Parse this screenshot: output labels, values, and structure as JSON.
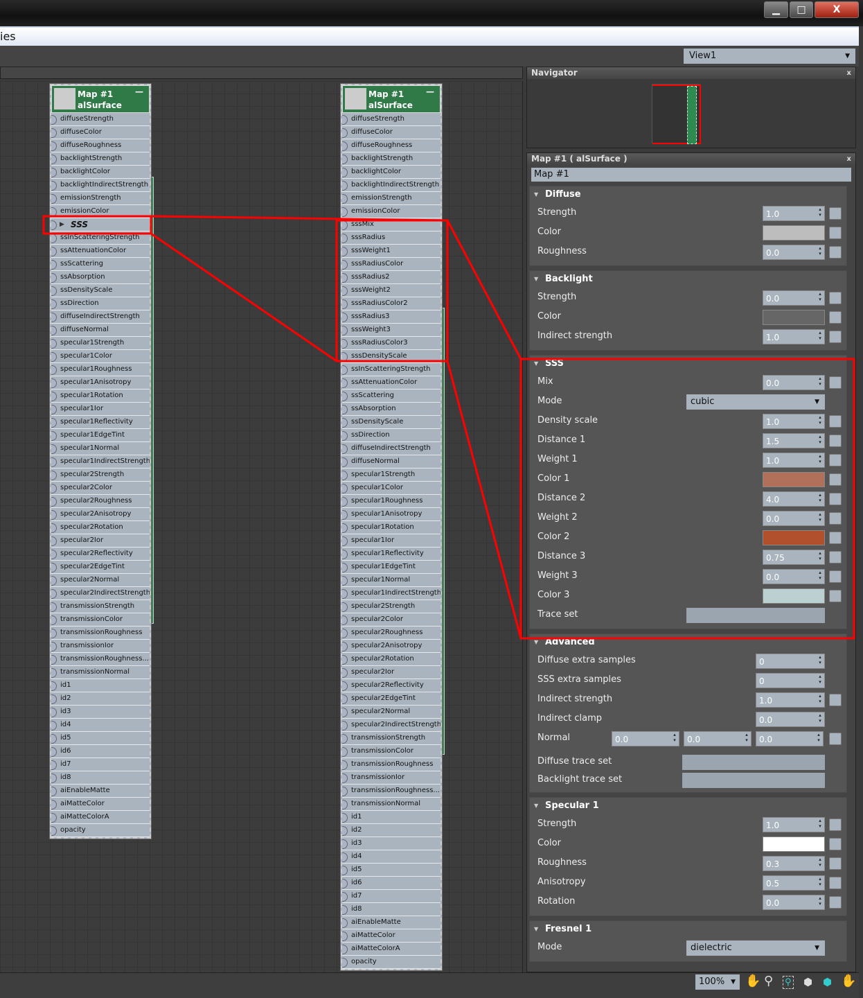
{
  "window": {
    "title_fragment": "ies",
    "view_select": "View1",
    "minimize": "▁",
    "maximize": "□",
    "close": "X"
  },
  "navigator": {
    "title": "Navigator",
    "close": "x"
  },
  "nodes": [
    {
      "title": "Map #1",
      "type": "alSurface",
      "ports": [
        "diffuseStrength",
        "diffuseColor",
        "diffuseRoughness",
        "backlightStrength",
        "backlightColor",
        "backlightIndirectStrength",
        "emissionStrength",
        "emissionColor",
        {
          "group": "SSS"
        },
        "ssInScatteringStrength",
        "ssAttenuationColor",
        "ssScattering",
        "ssAbsorption",
        "ssDensityScale",
        "ssDirection",
        "diffuseIndirectStrength",
        "diffuseNormal",
        "specular1Strength",
        "specular1Color",
        "specular1Roughness",
        "specular1Anisotropy",
        "specular1Rotation",
        "specular1Ior",
        "specular1Reflectivity",
        "specular1EdgeTint",
        "specular1Normal",
        "specular1IndirectStrength",
        "specular2Strength",
        "specular2Color",
        "specular2Roughness",
        "specular2Anisotropy",
        "specular2Rotation",
        "specular2Ior",
        "specular2Reflectivity",
        "specular2EdgeTint",
        "specular2Normal",
        "specular2IndirectStrength",
        "transmissionStrength",
        "transmissionColor",
        "transmissionRoughness",
        "transmissionIor",
        "transmissionRoughness...",
        "transmissionNormal",
        "id1",
        "id2",
        "id3",
        "id4",
        "id5",
        "id6",
        "id7",
        "id8",
        "aiEnableMatte",
        "aiMatteColor",
        "aiMatteColorA",
        "opacity"
      ]
    },
    {
      "title": "Map #1",
      "type": "alSurface",
      "ports": [
        "diffuseStrength",
        "diffuseColor",
        "diffuseRoughness",
        "backlightStrength",
        "backlightColor",
        "backlightIndirectStrength",
        "emissionStrength",
        "emissionColor",
        "sssMix",
        "sssRadius",
        "sssWeight1",
        "sssRadiusColor",
        "sssRadius2",
        "sssWeight2",
        "sssRadiusColor2",
        "sssRadius3",
        "sssWeight3",
        "sssRadiusColor3",
        "sssDensityScale",
        "ssInScatteringStrength",
        "ssAttenuationColor",
        "ssScattering",
        "ssAbsorption",
        "ssDensityScale",
        "ssDirection",
        "diffuseIndirectStrength",
        "diffuseNormal",
        "specular1Strength",
        "specular1Color",
        "specular1Roughness",
        "specular1Anisotropy",
        "specular1Rotation",
        "specular1Ior",
        "specular1Reflectivity",
        "specular1EdgeTint",
        "specular1Normal",
        "specular1IndirectStrength",
        "specular2Strength",
        "specular2Color",
        "specular2Roughness",
        "specular2Anisotropy",
        "specular2Rotation",
        "specular2Ior",
        "specular2Reflectivity",
        "specular2EdgeTint",
        "specular2Normal",
        "specular2IndirectStrength",
        "transmissionStrength",
        "transmissionColor",
        "transmissionRoughness",
        "transmissionIor",
        "transmissionRoughness...",
        "transmissionNormal",
        "id1",
        "id2",
        "id3",
        "id4",
        "id5",
        "id6",
        "id7",
        "id8",
        "aiEnableMatte",
        "aiMatteColor",
        "aiMatteColorA",
        "opacity"
      ]
    }
  ],
  "properties": {
    "title": "Map #1  ( alSurface )",
    "close": "x",
    "map_name": "Map #1",
    "rollouts": [
      {
        "title": "Diffuse",
        "rows": [
          {
            "label": "Strength",
            "kind": "spin",
            "value": "1.0"
          },
          {
            "label": "Color",
            "kind": "color",
            "color": "#bdbdbd"
          },
          {
            "label": "Roughness",
            "kind": "spin",
            "value": "0.0"
          }
        ]
      },
      {
        "title": "Backlight",
        "rows": [
          {
            "label": "Strength",
            "kind": "spin",
            "value": "0.0"
          },
          {
            "label": "Color",
            "kind": "color",
            "color": "#666666"
          },
          {
            "label": "Indirect strength",
            "kind": "spin",
            "value": "1.0"
          }
        ]
      },
      {
        "title": "SSS",
        "rows": [
          {
            "label": "Mix",
            "kind": "spin",
            "value": "0.0"
          },
          {
            "label": "Mode",
            "kind": "drop",
            "value": "cubic"
          },
          {
            "label": "Density scale",
            "kind": "spin",
            "value": "1.0"
          },
          {
            "label": "Distance 1",
            "kind": "spin",
            "value": "1.5"
          },
          {
            "label": "Weight 1",
            "kind": "spin",
            "value": "1.0"
          },
          {
            "label": "Color 1",
            "kind": "color",
            "color": "#b0705a"
          },
          {
            "label": "Distance 2",
            "kind": "spin",
            "value": "4.0"
          },
          {
            "label": "Weight 2",
            "kind": "spin",
            "value": "0.0"
          },
          {
            "label": "Color 2",
            "kind": "color",
            "color": "#b0502d"
          },
          {
            "label": "Distance 3",
            "kind": "spin",
            "value": "0.75"
          },
          {
            "label": "Weight 3",
            "kind": "spin",
            "value": "0.0"
          },
          {
            "label": "Color 3",
            "kind": "color",
            "color": "#bcd0d2"
          },
          {
            "label": "Trace set",
            "kind": "slot"
          }
        ]
      },
      {
        "title": "Advanced",
        "rows": [
          {
            "label": "Diffuse extra samples",
            "kind": "spinw",
            "value": "0"
          },
          {
            "label": "SSS extra samples",
            "kind": "spinw",
            "value": "0"
          },
          {
            "label": "Indirect strength",
            "kind": "spinw",
            "value": "1.0",
            "map": true
          },
          {
            "label": "Indirect clamp",
            "kind": "spinw",
            "value": "0.0"
          },
          {
            "label": "Normal",
            "kind": "xyz",
            "values": [
              "0.0",
              "0.0",
              "0.0"
            ]
          },
          {
            "label": "Diffuse trace set",
            "kind": "slotw"
          },
          {
            "label": "Backlight trace set",
            "kind": "slotw"
          }
        ]
      },
      {
        "title": "Specular 1",
        "rows": [
          {
            "label": "Strength",
            "kind": "spin",
            "value": "1.0"
          },
          {
            "label": "Color",
            "kind": "color",
            "color": "#ffffff"
          },
          {
            "label": "Roughness",
            "kind": "spin",
            "value": "0.3"
          },
          {
            "label": "Anisotropy",
            "kind": "spin",
            "value": "0.5"
          },
          {
            "label": "Rotation",
            "kind": "spin",
            "value": "0.0"
          }
        ]
      },
      {
        "title": "Fresnel 1",
        "rows": [
          {
            "label": "Mode",
            "kind": "drop",
            "value": "dielectric"
          }
        ]
      }
    ]
  },
  "statusbar": {
    "zoom": "100%",
    "tools": [
      "pan-hand-icon",
      "zoom-icon",
      "zoom-region-icon",
      "zoom-extents-icon",
      "zoom-extents-selected-icon",
      "pan-mode-hand-icon"
    ]
  },
  "colors": {
    "node_header": "#2f7a47",
    "annotation": "#ff0000"
  }
}
